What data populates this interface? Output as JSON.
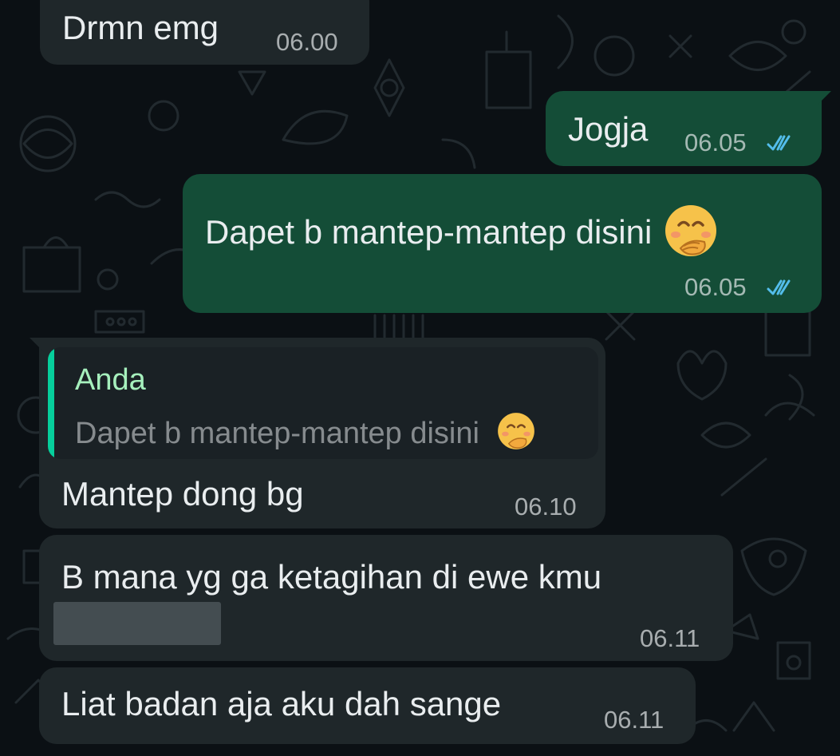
{
  "messages": [
    {
      "id": "m1",
      "direction": "incoming",
      "text": "Drmn emg",
      "time": "06.00"
    },
    {
      "id": "m2",
      "direction": "outgoing",
      "text": "Jogja",
      "time": "06.05",
      "status_icon": "double-check-icon"
    },
    {
      "id": "m3",
      "direction": "outgoing",
      "text": "Dapet b mantep-mantep disini",
      "emoji_icon": "face-with-hand-over-mouth-icon",
      "time": "06.05",
      "status_icon": "double-check-icon"
    },
    {
      "id": "m4",
      "direction": "incoming",
      "reply": {
        "author": "Anda",
        "text": "Dapet b mantep-mantep disini",
        "emoji_icon": "face-with-hand-over-mouth-icon"
      },
      "text": "Mantep dong bg",
      "time": "06.10"
    },
    {
      "id": "m5",
      "direction": "incoming",
      "text": "B mana yg ga ketagihan di ewe kmu",
      "time": "06.11",
      "redacted_line": true
    },
    {
      "id": "m6",
      "direction": "incoming",
      "text": "Liat badan aja aku dah sange",
      "time": "06.11"
    }
  ],
  "colors": {
    "background": "#0b1014",
    "incoming_bubble": "#1f272a",
    "outgoing_bubble": "#144d37",
    "read_tick": "#53bdeb",
    "quote_bar": "#06cf9c",
    "quote_author": "#a6f0bd"
  }
}
